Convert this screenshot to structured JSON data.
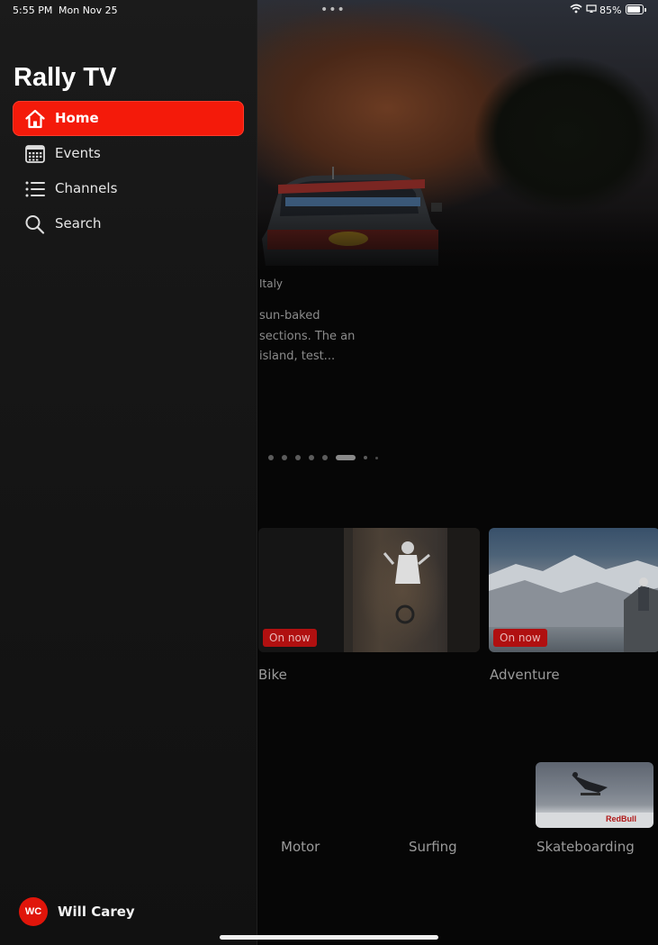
{
  "status_bar": {
    "time": "5:55 PM",
    "date": "Mon Nov 25",
    "battery": "85%",
    "battery_level": 0.85
  },
  "sidebar": {
    "app_title": "Rally TV",
    "active_color": "#f41a0a",
    "items": [
      {
        "label": "Home",
        "icon": "home-icon",
        "active": true
      },
      {
        "label": "Events",
        "icon": "calendar-icon",
        "active": false
      },
      {
        "label": "Channels",
        "icon": "list-icon",
        "active": false
      },
      {
        "label": "Search",
        "icon": "search-icon",
        "active": false
      }
    ],
    "profile": {
      "initials": "WC",
      "name": "Will Carey"
    }
  },
  "hero": {
    "country": "Italy",
    "description": "sun-baked sections. The an island, test...",
    "pager": {
      "count": 9,
      "active_index": 5
    }
  },
  "live_cards": [
    {
      "title": "Bike",
      "badge": "On now"
    },
    {
      "title": "Adventure",
      "badge": "On now"
    }
  ],
  "categories": [
    {
      "label": "Motor"
    },
    {
      "label": "Surfing"
    },
    {
      "label": "Skateboarding"
    }
  ]
}
